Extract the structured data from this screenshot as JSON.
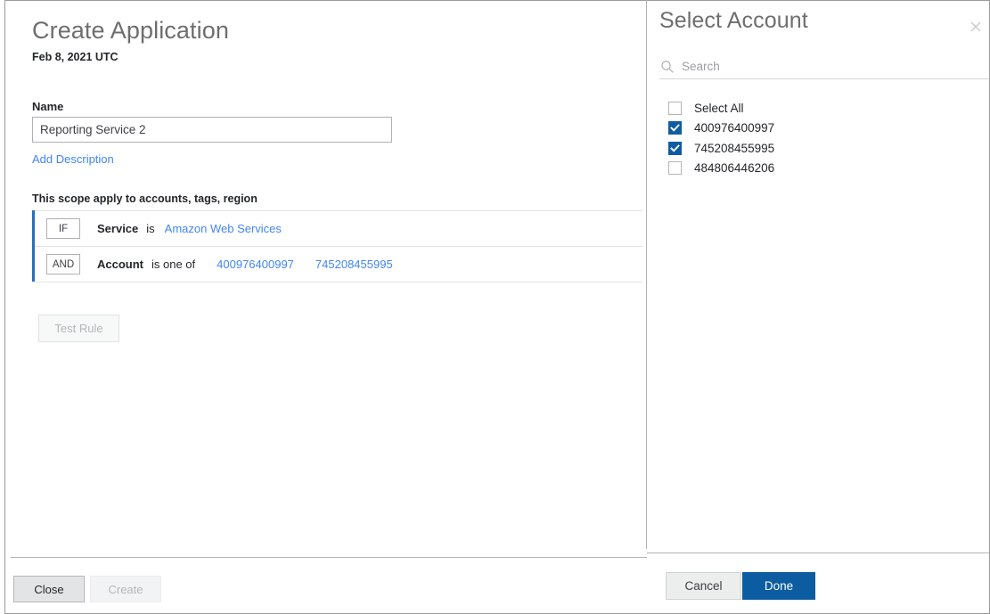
{
  "left": {
    "title": "Create Application",
    "subtitle": "Feb 8, 2021 UTC",
    "name_label": "Name",
    "name_value": "Reporting Service 2",
    "name_placeholder": "",
    "add_description_label": "Add Description",
    "scope_note": "This scope apply to accounts, tags, region",
    "rules": [
      {
        "operator": "IF",
        "attribute": "Service",
        "comparator": "is",
        "values": [
          "Amazon Web Services"
        ]
      },
      {
        "operator": "AND",
        "attribute": "Account",
        "comparator": "is one of",
        "values": [
          "400976400997",
          "745208455995"
        ]
      }
    ],
    "test_rule_label": "Test Rule",
    "footer": {
      "close_label": "Close",
      "create_label": "Create"
    }
  },
  "right": {
    "title": "Select Account",
    "close_icon": "close-icon",
    "search": {
      "icon": "search-icon",
      "placeholder": "Search",
      "value": ""
    },
    "accounts": [
      {
        "label": "Select All",
        "checked": false
      },
      {
        "label": "400976400997",
        "checked": true
      },
      {
        "label": "745208455995",
        "checked": true
      },
      {
        "label": "484806446206",
        "checked": false
      }
    ],
    "footer": {
      "cancel_label": "Cancel",
      "done_label": "Done"
    }
  },
  "colors": {
    "link": "#4285f4",
    "accent_bar": "#2a6ebb",
    "checkbox_checked": "#0f5ca0",
    "primary_button": "#0b5ca0",
    "title_text": "#6e6e6e",
    "body_text": "#23262a"
  }
}
